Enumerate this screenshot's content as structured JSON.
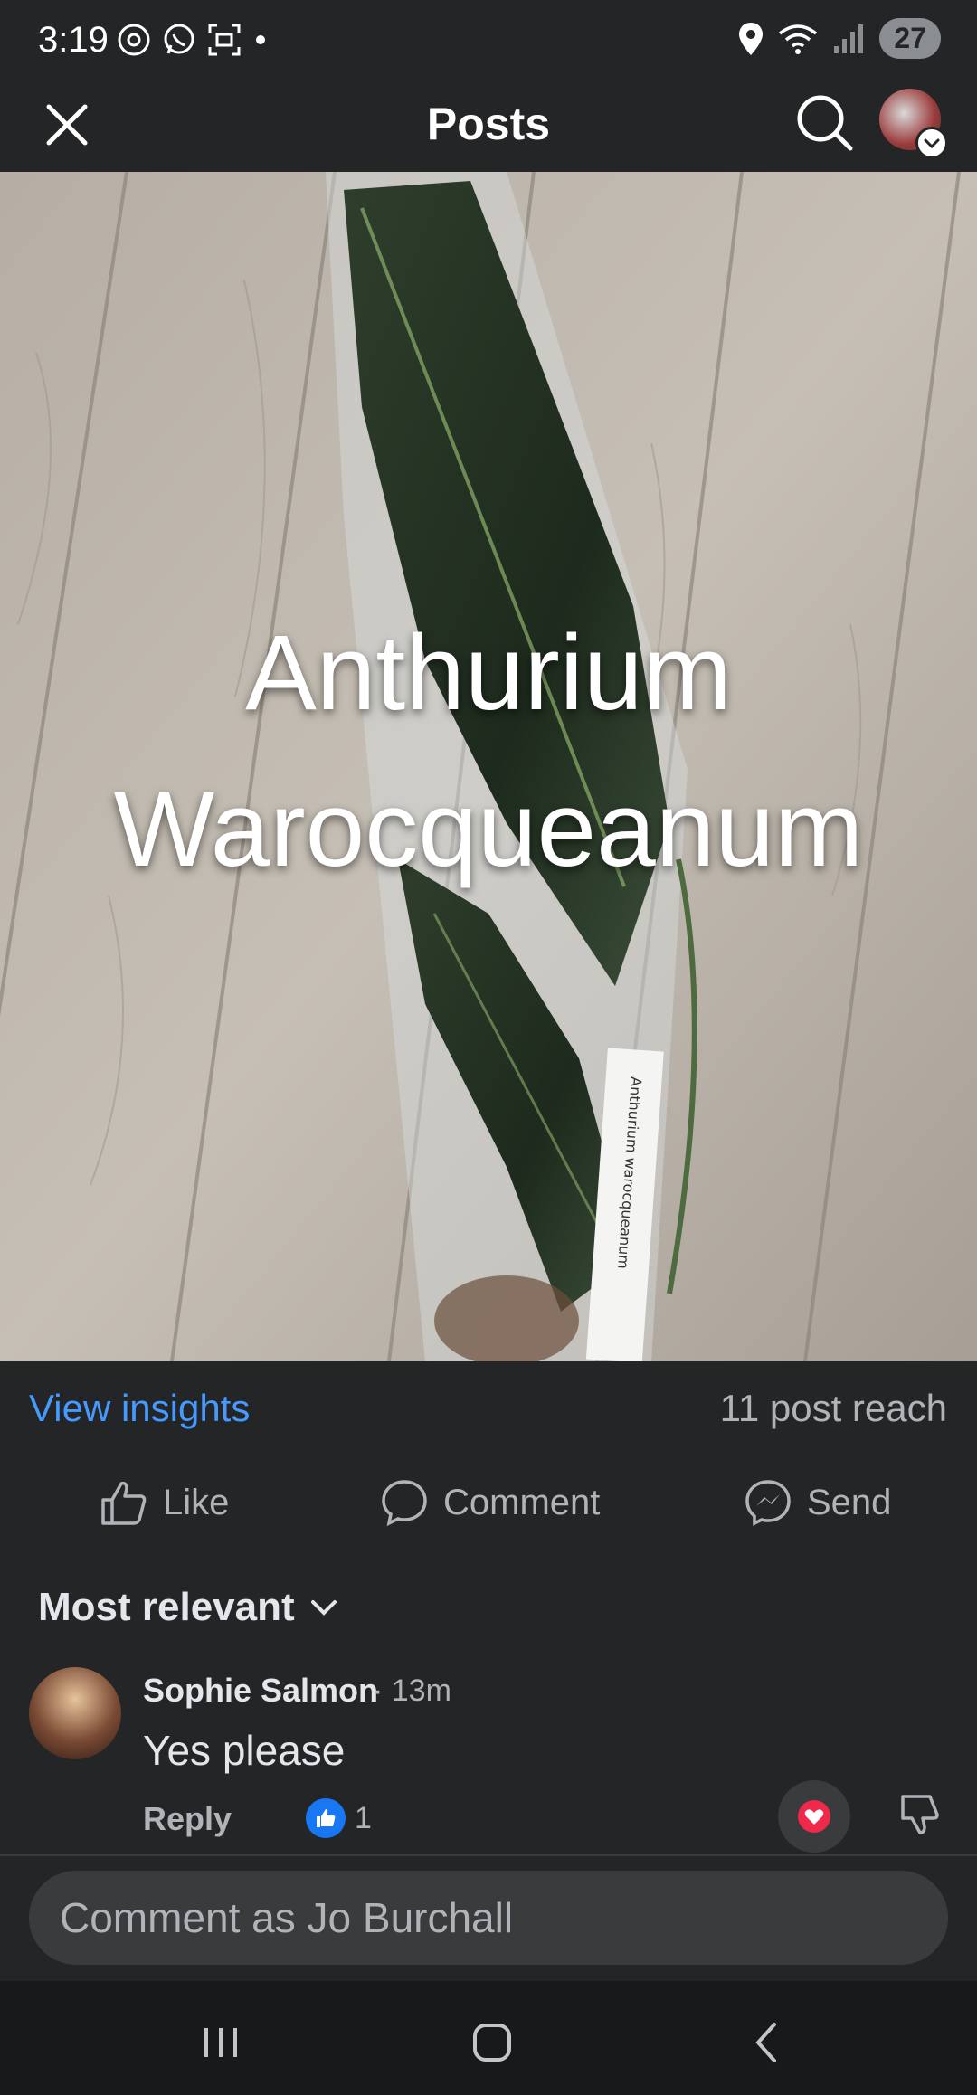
{
  "status_bar": {
    "time": "3:19",
    "battery": "27",
    "left_icons": [
      "threads-icon",
      "whatsapp-icon",
      "screenshot-icon",
      "dot-icon"
    ],
    "right_icons": [
      "location-icon",
      "wifi-icon",
      "signal-icon"
    ]
  },
  "header": {
    "title": "Posts",
    "close_icon": "close-icon",
    "search_icon": "search-icon"
  },
  "post": {
    "overlay_line1": "Anthurium",
    "overlay_line2": "Warocqueanum",
    "label_text": "Anthurium warocqueanum"
  },
  "insights": {
    "link": "View insights",
    "reach": "11 post reach"
  },
  "actions": {
    "like": "Like",
    "comment": "Comment",
    "send": "Send"
  },
  "comments_section": {
    "sort_label": "Most relevant",
    "items": [
      {
        "author": "Sophie Salmon",
        "time": "· 13m",
        "text": "Yes please",
        "reply_label": "Reply",
        "likes": "1"
      }
    ]
  },
  "composer": {
    "placeholder": "Comment as Jo Burchall"
  },
  "colors": {
    "background": "#242526",
    "link_blue": "#4599ff",
    "like_blue": "#1877f2",
    "heart_red": "#f02849"
  }
}
